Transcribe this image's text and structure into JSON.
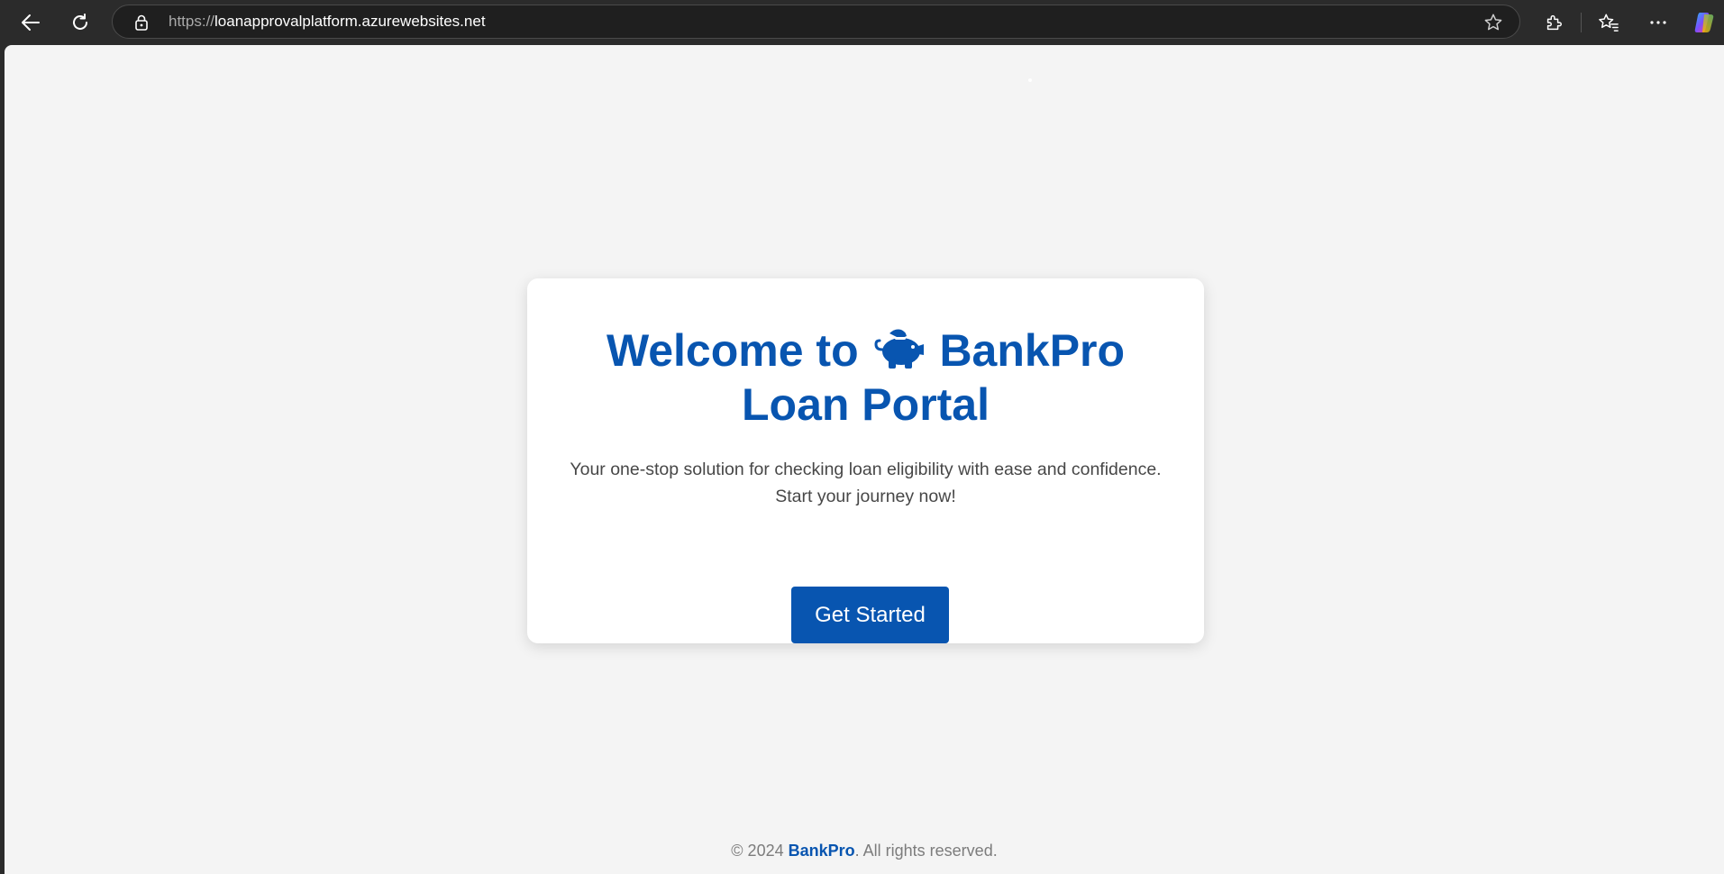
{
  "browser": {
    "url_scheme": "https://",
    "url_host": "loanapprovalplatform.azurewebsites.net",
    "icons": {
      "back": "back-arrow-icon",
      "refresh": "refresh-icon",
      "lock": "lock-icon",
      "favorite": "star-icon",
      "extensions": "puzzle-icon",
      "favorites": "favorites-star-icon",
      "more": "more-dots-icon",
      "copilot": "copilot-icon"
    }
  },
  "hero": {
    "title_part1": "Welcome to",
    "title_part2": "BankPro",
    "title_line2": "Loan Portal",
    "icon": "piggy-bank-icon",
    "subtitle_line1": "Your one-stop solution for checking loan eligibility with ease and confidence.",
    "subtitle_line2": "Start your journey now!",
    "cta_label": "Get Started"
  },
  "footer": {
    "prefix": "© 2024 ",
    "brand": "BankPro",
    "suffix": ". All rights reserved."
  },
  "colors": {
    "brand_blue": "#0855b0",
    "page_bg": "#f4f4f4",
    "chrome_bg": "#2b2b2b"
  }
}
